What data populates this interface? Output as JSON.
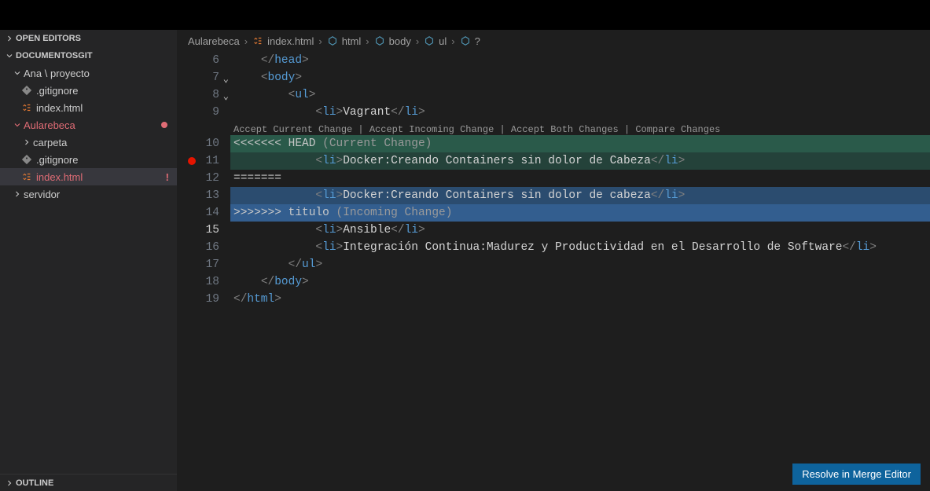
{
  "sections": {
    "open_editors": "OPEN EDITORS",
    "documentosgit": "DOCUMENTOSGIT",
    "outline": "OUTLINE"
  },
  "tree": {
    "ana": {
      "label": "Ana \\ proyecto"
    },
    "ana_gitignore": ".gitignore",
    "ana_index": "index.html",
    "aularebeca": "Aularebeca",
    "carpeta": "carpeta",
    "aula_gitignore": ".gitignore",
    "aula_index": "index.html",
    "servidor": "servidor",
    "error_marker": "!"
  },
  "breadcrumbs": {
    "root": "Aularebeca",
    "file": "index.html",
    "p1": "html",
    "p2": "body",
    "p3": "ul",
    "p4": "?"
  },
  "gutter": {
    "l6": "6",
    "l7": "7",
    "l8": "8",
    "l9": "9",
    "l10": "10",
    "l11": "11",
    "l12": "12",
    "l13": "13",
    "l14": "14",
    "l15": "15",
    "l16": "16",
    "l17": "17",
    "l18": "18",
    "l19": "19"
  },
  "codelens": {
    "accept_current": "Accept Current Change",
    "accept_incoming": "Accept Incoming Change",
    "accept_both": "Accept Both Changes",
    "compare": "Compare Changes"
  },
  "code": {
    "head_close": "head",
    "body": "body",
    "ul": "ul",
    "li": "li",
    "html": "html",
    "vagrant": "Vagrant",
    "conflict_start": "<<<<<<< HEAD",
    "current_label": " (Current Change)",
    "docker_current": "Docker:Creando Containers sin dolor de Cabeza",
    "separator": "=======",
    "docker_incoming": "Docker:Creando Containers sin dolor de cabeza",
    "conflict_end": ">>>>>>> titulo",
    "incoming_label": " (Incoming Change)",
    "ansible": "Ansible",
    "integracion": "Integración Continua:Madurez y Productividad en el Desarrollo de Software"
  },
  "resolve_button": "Resolve in Merge Editor"
}
